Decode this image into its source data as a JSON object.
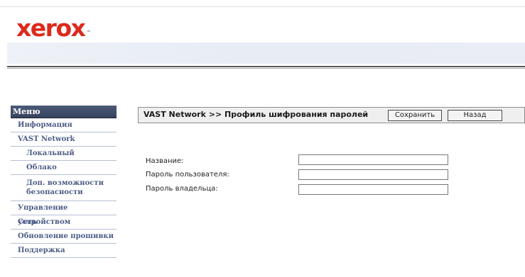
{
  "brand": {
    "logo_text": "xerox",
    "trademark": "™",
    "logo_color": "#dd2a1b"
  },
  "sidebar": {
    "header": "Меню",
    "items": [
      {
        "label": "Информация",
        "level": 1
      },
      {
        "label": "VAST Network",
        "level": 1
      },
      {
        "label": "Локальный",
        "level": 2
      },
      {
        "label": "Облако",
        "level": 2
      },
      {
        "label": "Доп. возможности безопасности",
        "level": 2
      },
      {
        "label": "Управление устройством",
        "level": 1
      },
      {
        "label": "Сеть",
        "level": 1
      },
      {
        "label": "Обновление прошивки",
        "level": 1
      },
      {
        "label": "Поддержка",
        "level": 1
      }
    ]
  },
  "content": {
    "title": "VAST Network >> Профиль шифрования паролей",
    "save_label": "Сохранить",
    "back_label": "Назад"
  },
  "form": {
    "name": {
      "label": "Название:",
      "value": ""
    },
    "user_password": {
      "label": "Пароль пользователя:",
      "value": ""
    },
    "owner_password": {
      "label": "Пароль владельца:",
      "value": ""
    }
  },
  "colors": {
    "menu_header_bg": "#3f4c69",
    "menu_item_text": "#4d5d86",
    "banner_bg": "#e9edf5"
  }
}
